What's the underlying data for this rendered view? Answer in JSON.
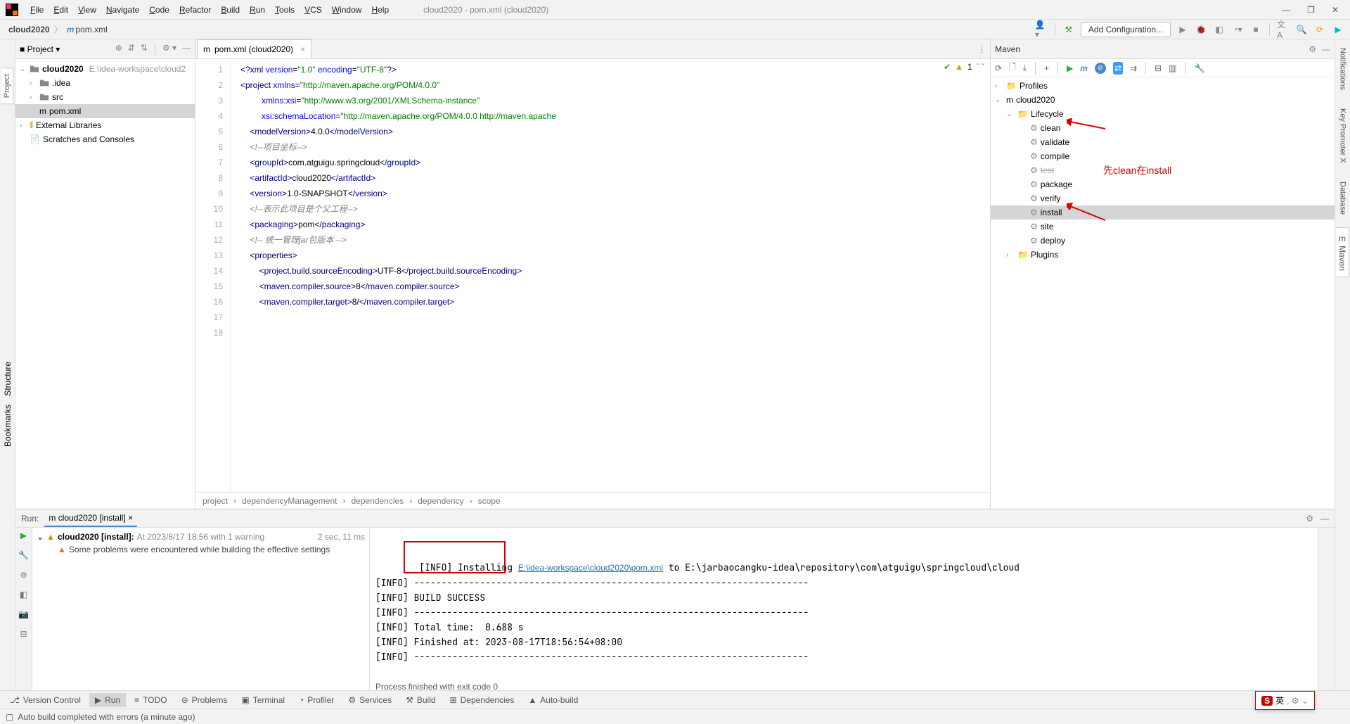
{
  "window": {
    "title": "cloud2020 - pom.xml (cloud2020)"
  },
  "menu": [
    "File",
    "Edit",
    "View",
    "Navigate",
    "Code",
    "Refactor",
    "Build",
    "Run",
    "Tools",
    "VCS",
    "Window",
    "Help"
  ],
  "breadcrumb": {
    "project": "cloud2020",
    "file": "pom.xml"
  },
  "navbar": {
    "config_btn": "Add Configuration..."
  },
  "left_tabs": {
    "project": "Project",
    "bookmarks": "Bookmarks",
    "structure": "Structure"
  },
  "right_tabs": {
    "notifications": "Notifications",
    "keypromoter": "Key Promoter X",
    "database": "Database",
    "maven": "Maven"
  },
  "project_panel": {
    "title": "Project",
    "root": {
      "name": "cloud2020",
      "path": "E:\\idea-workspace\\cloud2"
    },
    "children": [
      {
        "name": ".idea",
        "type": "folder"
      },
      {
        "name": "src",
        "type": "folder"
      },
      {
        "name": "pom.xml",
        "type": "file",
        "selected": true
      }
    ],
    "extra": [
      {
        "name": "External Libraries"
      },
      {
        "name": "Scratches and Consoles"
      }
    ]
  },
  "editor": {
    "tab": "pom.xml (cloud2020)",
    "status": {
      "check": "✔",
      "warnings": "1"
    },
    "line_start": 1,
    "line_end": 18,
    "breadcrumbs": [
      "project",
      "dependencyManagement",
      "dependencies",
      "dependency",
      "scope"
    ]
  },
  "code_lines": [
    {
      "n": 1,
      "html": "<span class='c-tag'>&lt;?xml</span> <span class='c-attr'>version</span>=<span class='c-str'>\"1.0\"</span> <span class='c-attr'>encoding</span>=<span class='c-str'>\"UTF-8\"</span><span class='c-tag'>?&gt;</span>"
    },
    {
      "n": 2,
      "html": "<span class='c-tag'>&lt;project</span> <span class='c-attr'>xmlns</span>=<span class='c-str'>\"http://maven.apache.org/POM/4.0.0\"</span>"
    },
    {
      "n": 3,
      "html": "         <span class='c-attr'>xmlns:xsi</span>=<span class='c-str'>\"http://www.w3.org/2001/XMLSchema-instance\"</span>"
    },
    {
      "n": 4,
      "html": "         <span class='c-attr'>xsi:schemaLocation</span>=<span class='c-str'>\"http://maven.apache.org/POM/4.0.0 http://maven.apache</span>"
    },
    {
      "n": 5,
      "html": "    <span class='c-tag'>&lt;modelVersion&gt;</span>4.0.0<span class='c-tag'>&lt;/modelVersion&gt;</span>"
    },
    {
      "n": 6,
      "html": ""
    },
    {
      "n": 7,
      "html": "    <span class='c-cmt'>&lt;!--项目坐标--&gt;</span>"
    },
    {
      "n": 8,
      "html": "    <span class='c-tag'>&lt;groupId&gt;</span>com.atguigu.springcloud<span class='c-tag'>&lt;/groupId&gt;</span>"
    },
    {
      "n": 9,
      "html": "    <span class='c-tag'>&lt;artifactId&gt;</span>cloud2020<span class='c-tag'>&lt;/artifactId&gt;</span>"
    },
    {
      "n": 10,
      "html": "    <span class='c-tag'>&lt;version&gt;</span>1.0-SNAPSHOT<span class='c-tag'>&lt;/version&gt;</span>"
    },
    {
      "n": 11,
      "html": "    <span class='c-cmt'>&lt;!--表示此项目是个父工程--&gt;</span>"
    },
    {
      "n": 12,
      "html": "    <span class='c-tag'>&lt;packaging&gt;</span>pom<span class='c-tag'>&lt;/packaging&gt;</span>"
    },
    {
      "n": 13,
      "html": ""
    },
    {
      "n": 14,
      "html": "    <span class='c-cmt'>&lt;!-- 统一管理jar包版本 --&gt;</span>"
    },
    {
      "n": 15,
      "html": "    <span class='c-tag'>&lt;properties&gt;</span>"
    },
    {
      "n": 16,
      "html": "        <span class='c-tag'>&lt;project.build.sourceEncoding&gt;</span>UTF-8<span class='c-tag'>&lt;/project.build.sourceEncoding&gt;</span>"
    },
    {
      "n": 17,
      "html": "        <span class='c-tag'>&lt;maven.compiler.source&gt;</span>8<span class='c-tag'>&lt;/maven.compiler.source&gt;</span>"
    },
    {
      "n": 18,
      "html": "        <span class='c-tag'>&lt;maven.compiler.target&gt;</span>8/<span class='c-tag'>&lt;/maven.compiler.target&gt;</span>"
    }
  ],
  "maven": {
    "title": "Maven",
    "tree": [
      {
        "label": "Profiles",
        "lvl": 0,
        "arr": "›"
      },
      {
        "label": "cloud2020",
        "lvl": 0,
        "arr": "⌄",
        "ic": "m"
      },
      {
        "label": "Lifecycle",
        "lvl": 1,
        "arr": "⌄",
        "ic": "folder"
      },
      {
        "label": "clean",
        "lvl": 2,
        "ic": "gear"
      },
      {
        "label": "validate",
        "lvl": 2,
        "ic": "gear"
      },
      {
        "label": "compile",
        "lvl": 2,
        "ic": "gear"
      },
      {
        "label": "test",
        "lvl": 2,
        "ic": "gear",
        "strike": true
      },
      {
        "label": "package",
        "lvl": 2,
        "ic": "gear"
      },
      {
        "label": "verify",
        "lvl": 2,
        "ic": "gear"
      },
      {
        "label": "install",
        "lvl": 2,
        "ic": "gear",
        "sel": true
      },
      {
        "label": "site",
        "lvl": 2,
        "ic": "gear"
      },
      {
        "label": "deploy",
        "lvl": 2,
        "ic": "gear"
      },
      {
        "label": "Plugins",
        "lvl": 1,
        "arr": "›",
        "ic": "folder"
      }
    ],
    "annotation": "先clean在install"
  },
  "run": {
    "header": {
      "label": "Run:",
      "tab": "cloud2020 [install]"
    },
    "tree": {
      "root": "cloud2020 [install]:",
      "time": "At 2023/8/17 18:56 with 1 warning",
      "dur": "2 sec, 11 ms",
      "child": "Some problems were encountered while building the effective settings"
    },
    "output": {
      "l1_pre": "[INFO] Installing ",
      "l1_link": "E:\\idea-workspace\\cloud2020\\pom.xml",
      "l1_post": " to E:\\jarbaocangku-idea\\repository\\com\\atguigu\\springcloud\\cloud",
      "l2": "[INFO] ------------------------------------------------------------------------",
      "l3": "[INFO] BUILD SUCCESS",
      "l4": "[INFO] ------------------------------------------------------------------------",
      "l5": "[INFO] Total time:  0.688 s",
      "l6": "[INFO] Finished at: 2023-08-17T18:56:54+08:00",
      "l7": "[INFO] ------------------------------------------------------------------------",
      "l8": "",
      "l9": "Process finished with exit code 0"
    }
  },
  "bottom_tabs": [
    {
      "icon": "vcs",
      "label": "Version Control"
    },
    {
      "icon": "run",
      "label": "Run",
      "active": true
    },
    {
      "icon": "todo",
      "label": "TODO"
    },
    {
      "icon": "prob",
      "label": "Problems"
    },
    {
      "icon": "term",
      "label": "Terminal"
    },
    {
      "icon": "prof",
      "label": "Profiler"
    },
    {
      "icon": "svc",
      "label": "Services"
    },
    {
      "icon": "build",
      "label": "Build"
    },
    {
      "icon": "dep",
      "label": "Dependencies"
    },
    {
      "icon": "auto",
      "label": "Auto-build"
    }
  ],
  "status": {
    "msg": "Auto build completed with errors (a minute ago)"
  },
  "ime": {
    "text": "英"
  }
}
